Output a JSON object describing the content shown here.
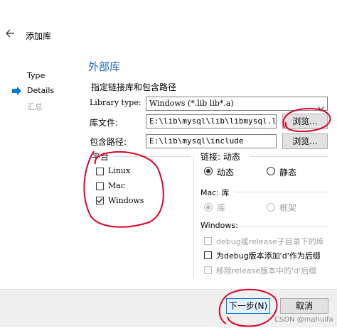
{
  "header": {
    "back_icon": "back-arrow-icon",
    "title": "添加库"
  },
  "steps": [
    {
      "label": "Type"
    },
    {
      "label": "Details"
    },
    {
      "label": "汇总"
    }
  ],
  "section_title": "外部库",
  "subtitle": "指定链接库和包含路径",
  "library_type": {
    "label": "Library type:",
    "value": "Windows (*.lib lib*.a)"
  },
  "library_file": {
    "label": "库文件:",
    "value": "E:\\lib\\mysql\\lib\\libmysql.lib",
    "browse": "浏览..."
  },
  "include_path": {
    "label": "包含路径:",
    "value": "E:\\lib\\mysql\\include",
    "browse": "浏览..."
  },
  "platform": {
    "label": "平台",
    "items": [
      {
        "label": "Linux",
        "checked": false
      },
      {
        "label": "Mac",
        "checked": false
      },
      {
        "label": "Windows",
        "checked": true
      }
    ]
  },
  "linkage": {
    "label": "链接: 动态",
    "options": [
      {
        "label": "动态",
        "selected": true
      },
      {
        "label": "静态",
        "selected": false
      }
    ]
  },
  "mac": {
    "label": "Mac: 库",
    "options": [
      {
        "label": "库",
        "selected": true
      },
      {
        "label": "框架",
        "selected": false
      }
    ]
  },
  "windows": {
    "label": "Windows:",
    "options": [
      {
        "label": "debug或release子目录下的库",
        "checked": false,
        "enabled": false
      },
      {
        "label": "为debug版本添加'd'作为后缀",
        "checked": false,
        "enabled": true
      },
      {
        "label": "移除release版本中的'd'后缀",
        "checked": false,
        "enabled": false
      }
    ]
  },
  "footer": {
    "next": "下一步(N)",
    "cancel": "取消",
    "watermark": "CSDN @mahuifa"
  },
  "colors": {
    "accent": "#0078d7",
    "annotation": "#e0002a",
    "footer_bg": "#f0f0f0"
  }
}
